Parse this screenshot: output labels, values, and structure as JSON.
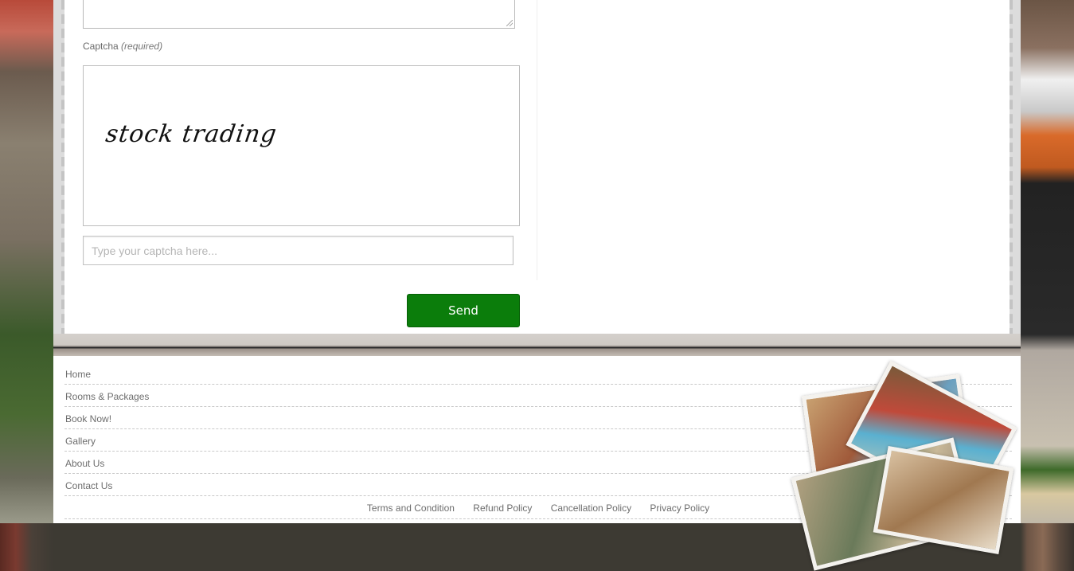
{
  "form": {
    "captcha_label": "Captcha",
    "captcha_required": "(required)",
    "captcha_image_text": "stock trading",
    "captcha_placeholder": "Type your captcha here...",
    "send_label": "Send"
  },
  "footer": {
    "nav": [
      "Home",
      "Rooms & Packages",
      "Book Now!",
      "Gallery",
      "About Us",
      "Contact Us"
    ],
    "policies": [
      "Terms and Condition",
      "Refund Policy",
      "Cancellation Policy",
      "Privacy Policy"
    ]
  },
  "colors": {
    "send_button": "#0b7d0b",
    "link_text": "#6d6d6d"
  }
}
